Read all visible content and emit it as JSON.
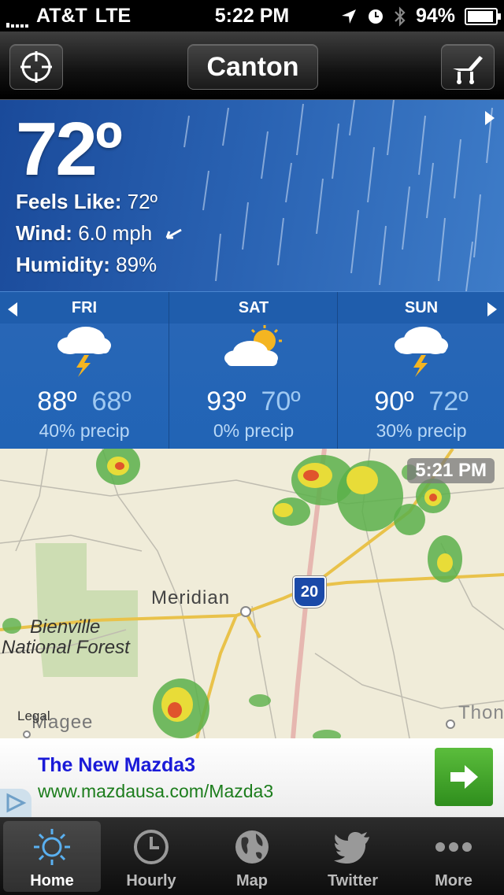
{
  "status": {
    "carrier": "AT&T",
    "network": "LTE",
    "time": "5:22 PM",
    "battery": "94%",
    "battery_level": 0.94
  },
  "nav": {
    "locate_icon": "crosshair-icon",
    "city": "Canton",
    "settings_icon": "chair-icon"
  },
  "current": {
    "temp": "72º",
    "feels_label": "Feels Like:",
    "feels_value": "72º",
    "wind_label": "Wind:",
    "wind_value": "6.0 mph",
    "humidity_label": "Humidity:",
    "humidity_value": "89%"
  },
  "forecast": [
    {
      "day": "FRI",
      "hi": "88º",
      "lo": "68º",
      "precip": "40% precip",
      "icon": "thunderstorm-icon"
    },
    {
      "day": "SAT",
      "hi": "93º",
      "lo": "70º",
      "precip": "0% precip",
      "icon": "partly-cloudy-icon"
    },
    {
      "day": "SUN",
      "hi": "90º",
      "lo": "72º",
      "precip": "30% precip",
      "icon": "thunderstorm-icon"
    }
  ],
  "map": {
    "timestamp": "5:21 PM",
    "city_label": "Meridian",
    "highway": "20",
    "forest_line1": "Bienville",
    "forest_line2": "National Forest",
    "legal": "Legal",
    "town_magee": "Magee",
    "town_thon": "Thon"
  },
  "ad": {
    "title": "The New Mazda3",
    "url": "www.mazdausa.com/Mazda3"
  },
  "tabs": [
    {
      "label": "Home",
      "icon": "sun-icon"
    },
    {
      "label": "Hourly",
      "icon": "clock-icon"
    },
    {
      "label": "Map",
      "icon": "globe-icon"
    },
    {
      "label": "Twitter",
      "icon": "twitter-bird-icon"
    },
    {
      "label": "More",
      "icon": "more-dots-icon"
    }
  ],
  "colors": {
    "accent": "#2164b5",
    "ad_title": "#1a1ad8",
    "ad_url": "#1c7d1c"
  }
}
